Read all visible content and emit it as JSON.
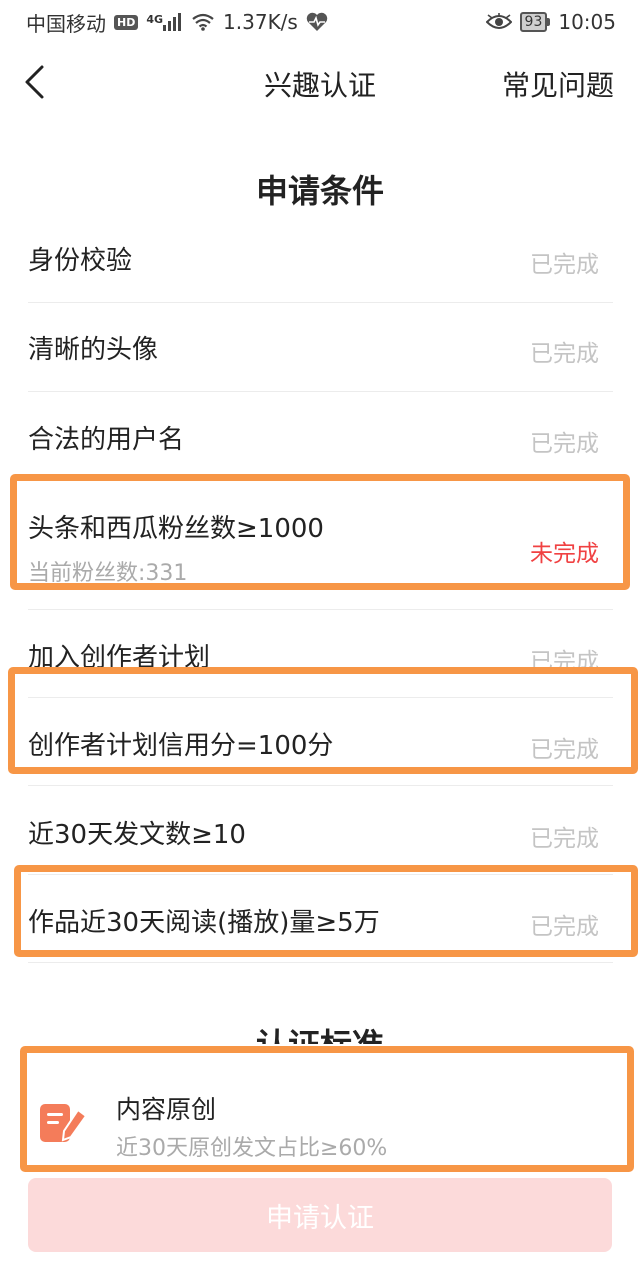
{
  "status_bar": {
    "carrier": "中国移动",
    "hd": "HD",
    "network": "4G",
    "speed": "1.37K/s",
    "battery": "93",
    "time": "10:05"
  },
  "nav": {
    "title": "兴趣认证",
    "faq": "常见问题"
  },
  "conditions": {
    "title": "申请条件",
    "items": [
      {
        "label": "身份校验",
        "status": "已完成"
      },
      {
        "label": "清晰的头像",
        "status": "已完成"
      },
      {
        "label": "合法的用户名",
        "status": "已完成"
      },
      {
        "label": "头条和西瓜粉丝数≥1000",
        "sub": "当前粉丝数:331",
        "status": "未完成"
      },
      {
        "label": "加入创作者计划",
        "status": "已完成"
      },
      {
        "label": "创作者计划信用分=100分",
        "status": "已完成"
      },
      {
        "label": "近30天发文数≥10",
        "status": "已完成"
      },
      {
        "label": "作品近30天阅读(播放)量≥5万",
        "status": "已完成"
      }
    ]
  },
  "standards": {
    "title": "认证标准",
    "items": [
      {
        "title": "内容原创",
        "desc": "近30天原创发文占比≥60%"
      }
    ]
  },
  "apply_button": "申请认证",
  "colors": {
    "highlight": "#f79646",
    "incomplete": "#f04142",
    "done": "#c4c4c4",
    "button_bg": "#fcdada",
    "icon": "#f47c5a"
  }
}
